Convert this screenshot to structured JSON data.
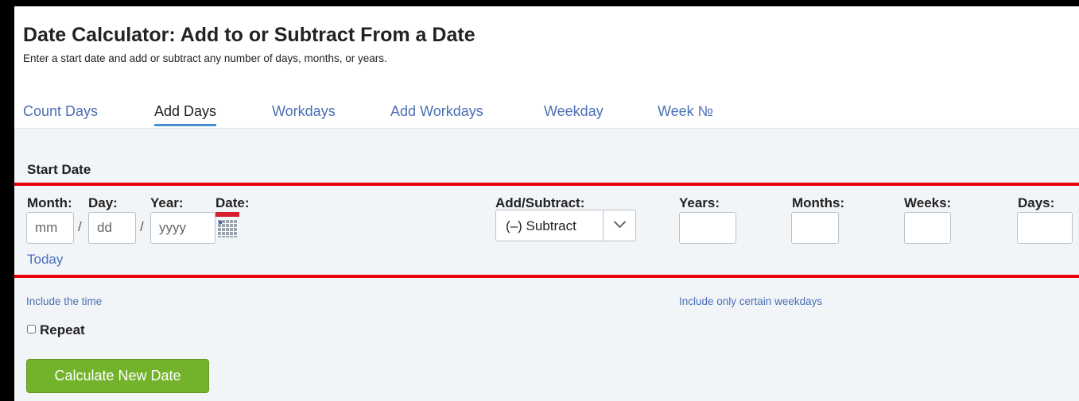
{
  "header": {
    "title": "Date Calculator: Add to or Subtract From a Date",
    "subtitle": "Enter a start date and add or subtract any number of days, months, or years."
  },
  "tabs": [
    {
      "label": "Count Days",
      "active": false
    },
    {
      "label": "Add Days",
      "active": true
    },
    {
      "label": "Workdays",
      "active": false
    },
    {
      "label": "Add Workdays",
      "active": false
    },
    {
      "label": "Weekday",
      "active": false
    },
    {
      "label": "Week №",
      "active": false
    }
  ],
  "form": {
    "section_title": "Start Date",
    "labels": {
      "month": "Month:",
      "day": "Day:",
      "year": "Year:",
      "date": "Date:",
      "add_subtract": "Add/Subtract:",
      "years": "Years:",
      "months": "Months:",
      "weeks": "Weeks:",
      "days": "Days:"
    },
    "placeholders": {
      "month": "mm",
      "day": "dd",
      "year": "yyyy"
    },
    "separator": "/",
    "operation": {
      "selected": "(–) Subtract"
    },
    "today_link": "Today",
    "include_time_link": "Include the time",
    "include_weekdays_link": "Include only certain weekdays",
    "repeat_label": "Repeat",
    "submit_label": "Calculate New Date"
  },
  "colors": {
    "link": "#4a6fb5",
    "tab_underline": "#4a8fd4",
    "highlight_border": "#e8000b",
    "button": "#73b32b",
    "panel_bg": "#f2f5f8"
  },
  "icons": {
    "calendar": "calendar-icon",
    "dropdown": "chevron-down-icon"
  }
}
